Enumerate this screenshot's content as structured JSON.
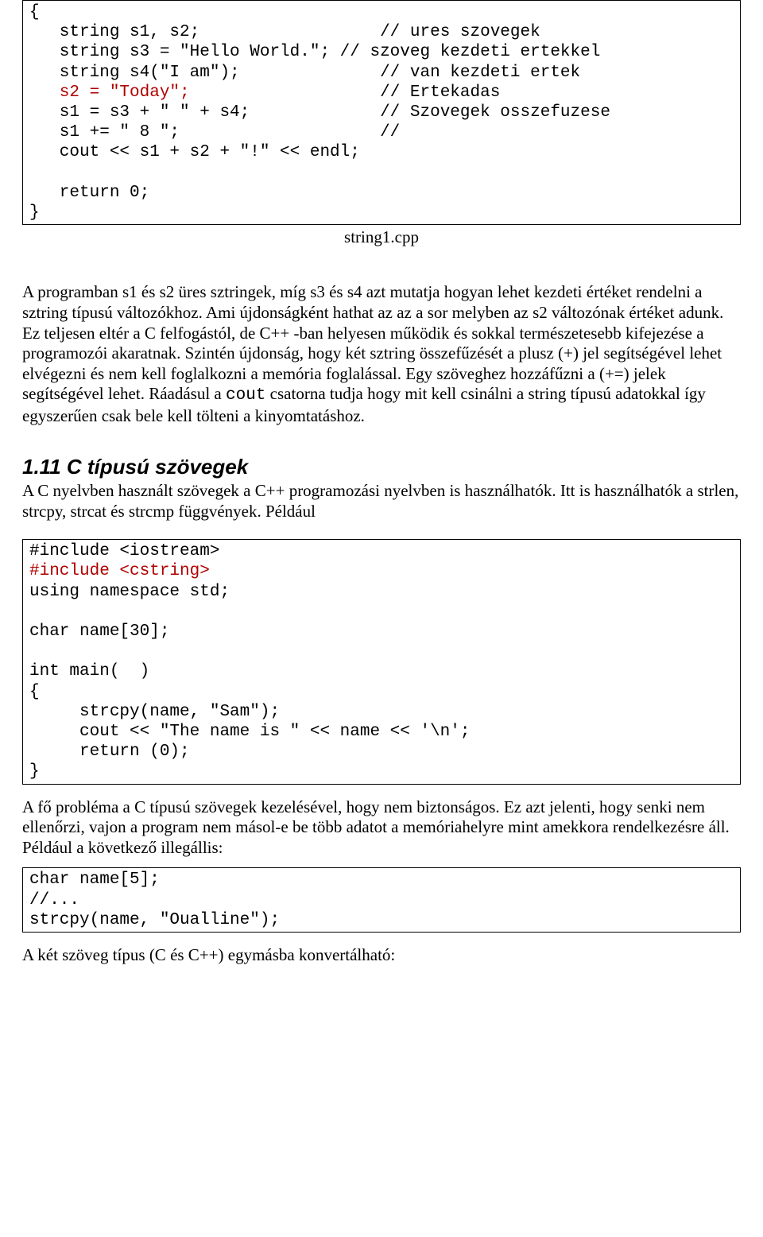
{
  "code1": {
    "line1": "{",
    "line2a": "   string s1, s2;                  ",
    "line2b": "// ures szovegek",
    "line3a": "   string s3 = \"Hello World.\"; ",
    "line3b": "// szoveg kezdeti ertekkel",
    "line4a": "   string s4(\"I am\");              ",
    "line4b": "// van kezdeti ertek",
    "line5a": "   s2 = \"Today\";",
    "line5pad": "                   ",
    "line5b": "// Ertekadas",
    "line6a": "   s1 = s3 + \" \" + s4;             ",
    "line6b": "// Szovegek osszefuzese",
    "line7a": "   s1 += \" 8 \";                    ",
    "line7b": "//",
    "line8": "   cout << s1 + s2 + \"!\" << endl;",
    "line9": "",
    "line10": "   return 0;",
    "line11": "}"
  },
  "caption1": "string1.cpp",
  "para1_a": "A programban s1 és s2 üres sztringek, míg s3 és s4 azt mutatja hogyan lehet kezdeti értéket rendelni a sztring típusú változókhoz. Ami újdonságként hathat az az a sor melyben az s2 változónak értéket adunk. Ez teljesen eltér a C felfogástól, de C++ -ban helyesen működik és sokkal természetesebb kifejezése a programozói akaratnak. Szintén újdonság, hogy két sztring összefűzését a plusz (+) jel segítségével lehet elvégezni és nem kell foglalkozni a memória foglalással. Egy szöveghez hozzáfűzni a (+=) jelek segítségével lehet. Ráadásul a ",
  "para1_cout": "cout",
  "para1_b": " csatorna tudja hogy mit kell csinálni a string típusú adatokkal így egyszerűen csak bele kell tölteni a kinyomtatáshoz.",
  "heading": "1.11 C típusú szövegek",
  "para2": "A C nyelvben használt szövegek a C++ programozási nyelvben is használhatók. Itt is használhatók a strlen, strcpy, strcat és strcmp függvények. Például",
  "code2": {
    "line1": "#include <iostream>",
    "line2": "#include <cstring>",
    "line3": "using namespace std;",
    "line4": "",
    "line5": "char name[30];",
    "line6": "",
    "line7": "int main(  )",
    "line8": "{",
    "line9": "     strcpy(name, \"Sam\");",
    "line10": "     cout << \"The name is \" << name << '\\n';",
    "line11": "     return (0);",
    "line12": "}"
  },
  "para3": "A fő probléma a C típusú szövegek kezelésével, hogy nem biztonságos. Ez azt jelenti, hogy senki nem ellenőrzi, vajon a program nem másol-e be több adatot a memóriahelyre mint amekkora rendelkezésre áll. Például a következő illegállis:",
  "code3": {
    "line1": "char name[5];",
    "line2": "//...",
    "line3": "strcpy(name, \"Oualline\");"
  },
  "para4": "A két szöveg típus (C és C++) egymásba konvertálható:"
}
